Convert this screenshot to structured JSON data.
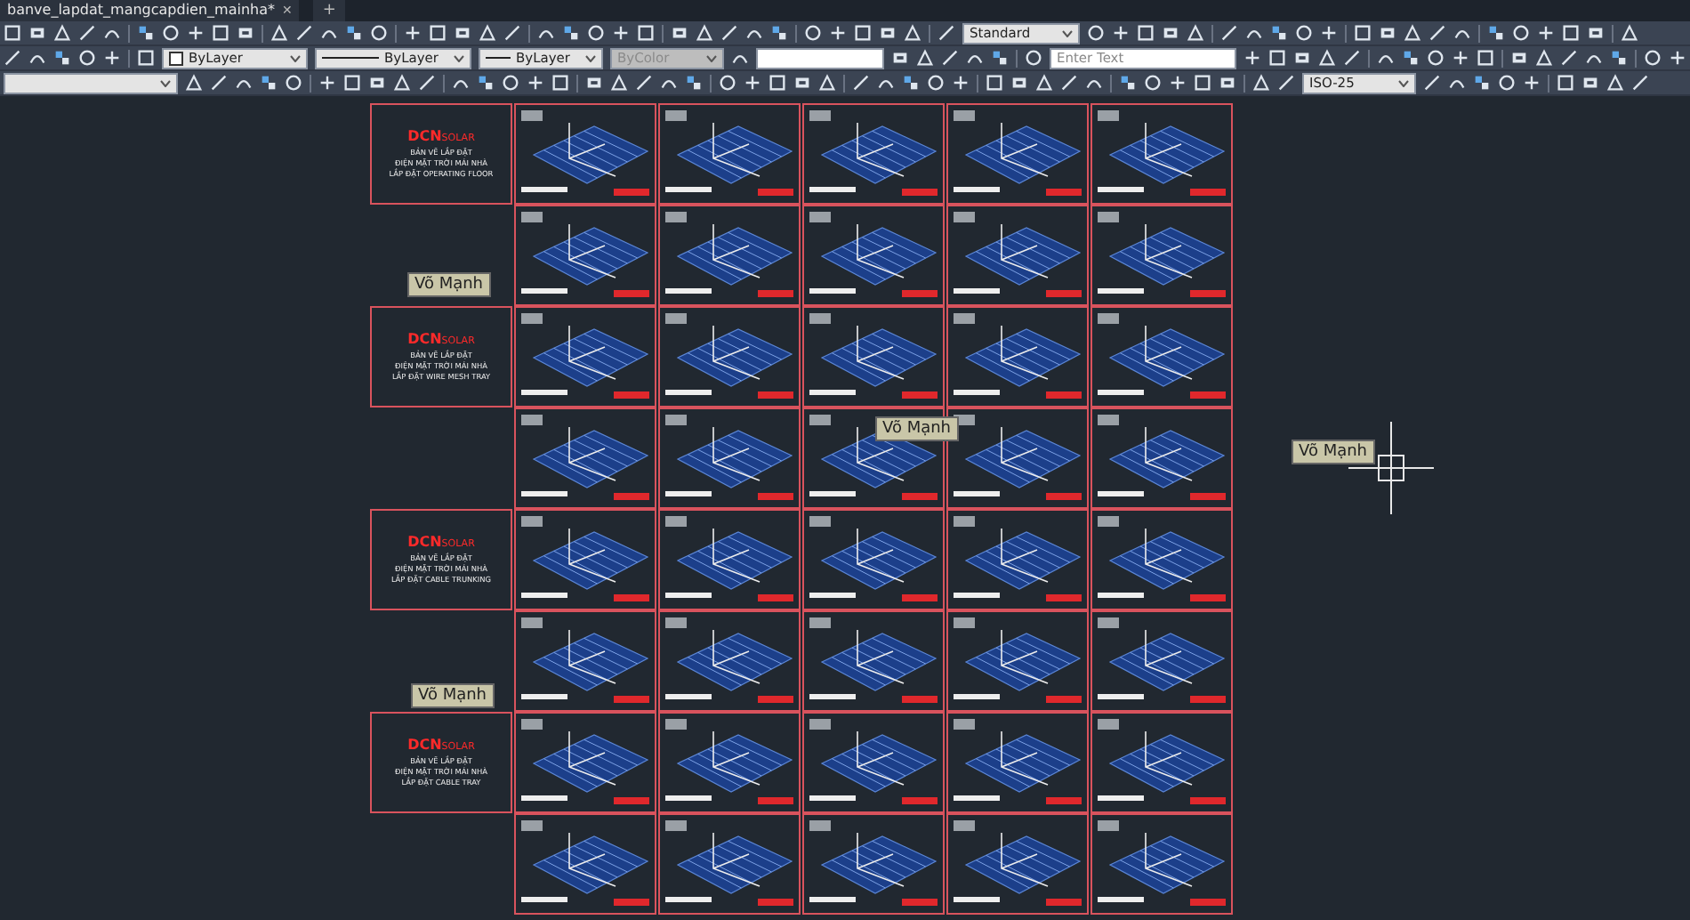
{
  "document_tab": {
    "title": "banve_lapdat_mangcapdien_mainha*",
    "close": "✕",
    "new_tab": "+"
  },
  "toolbar": {
    "text_style": "Standard",
    "color_setting": "ByLayer",
    "linetype": "ByLayer",
    "lineweight": "ByLayer",
    "plot_style": {
      "value": "ByColor",
      "disabled": true
    },
    "search": {
      "placeholder": "Enter Text"
    },
    "dim_style": "ISO-25"
  },
  "sheet_rows": [
    {
      "sheets": [
        {
          "kind": "title",
          "logo": "DCN",
          "logo_suffix": "SOLAR",
          "lines": [
            "BẢN VẼ LẮP ĐẶT",
            "ĐIỆN MẶT TRỜI MÁI NHÀ",
            "LẮP ĐẶT OPERATING FLOOR"
          ]
        },
        {
          "kind": "drawing"
        },
        {
          "kind": "drawing"
        },
        {
          "kind": "drawing"
        },
        {
          "kind": "drawing"
        },
        {
          "kind": "drawing"
        }
      ]
    },
    {
      "sheets": [
        {
          "kind": "blank"
        },
        {
          "kind": "drawing"
        },
        {
          "kind": "drawing"
        },
        {
          "kind": "drawing"
        },
        {
          "kind": "drawing"
        },
        {
          "kind": "drawing"
        }
      ]
    },
    {
      "sheets": [
        {
          "kind": "title",
          "logo": "DCN",
          "logo_suffix": "SOLAR",
          "lines": [
            "BẢN VẼ LẮP ĐẶT",
            "ĐIỆN MẶT TRỜI MÁI NHÀ",
            "LẮP ĐẶT WIRE MESH TRAY"
          ]
        },
        {
          "kind": "drawing"
        },
        {
          "kind": "drawing"
        },
        {
          "kind": "drawing"
        },
        {
          "kind": "drawing"
        },
        {
          "kind": "drawing"
        }
      ]
    },
    {
      "sheets": [
        {
          "kind": "blank"
        },
        {
          "kind": "drawing"
        },
        {
          "kind": "drawing"
        },
        {
          "kind": "drawing"
        },
        {
          "kind": "drawing"
        },
        {
          "kind": "drawing"
        }
      ]
    },
    {
      "sheets": [
        {
          "kind": "title",
          "logo": "DCN",
          "logo_suffix": "SOLAR",
          "lines": [
            "BẢN VẼ LẮP ĐẶT",
            "ĐIỆN MẶT TRỜI MÁI NHÀ",
            "LẮP ĐẶT CABLE TRUNKING"
          ]
        },
        {
          "kind": "drawing"
        },
        {
          "kind": "drawing"
        },
        {
          "kind": "drawing"
        },
        {
          "kind": "drawing"
        },
        {
          "kind": "drawing"
        }
      ]
    },
    {
      "sheets": [
        {
          "kind": "blank"
        },
        {
          "kind": "drawing"
        },
        {
          "kind": "drawing"
        },
        {
          "kind": "drawing"
        },
        {
          "kind": "drawing"
        },
        {
          "kind": "drawing"
        }
      ]
    },
    {
      "sheets": [
        {
          "kind": "title",
          "logo": "DCN",
          "logo_suffix": "SOLAR",
          "lines": [
            "BẢN VẼ LẮP ĐẶT",
            "ĐIỆN MẶT TRỜI MÁI NHÀ",
            "LẮP ĐẶT CABLE TRAY"
          ]
        },
        {
          "kind": "drawing"
        },
        {
          "kind": "drawing"
        },
        {
          "kind": "drawing"
        },
        {
          "kind": "drawing"
        },
        {
          "kind": "drawing"
        }
      ]
    },
    {
      "sheets": [
        {
          "kind": "blank"
        },
        {
          "kind": "drawing"
        },
        {
          "kind": "drawing"
        },
        {
          "kind": "drawing"
        },
        {
          "kind": "drawing"
        },
        {
          "kind": "drawing"
        }
      ]
    }
  ],
  "canvas_labels": [
    "Võ Mạnh",
    "Võ Mạnh",
    "Võ Mạnh",
    "Võ Mạnh"
  ]
}
